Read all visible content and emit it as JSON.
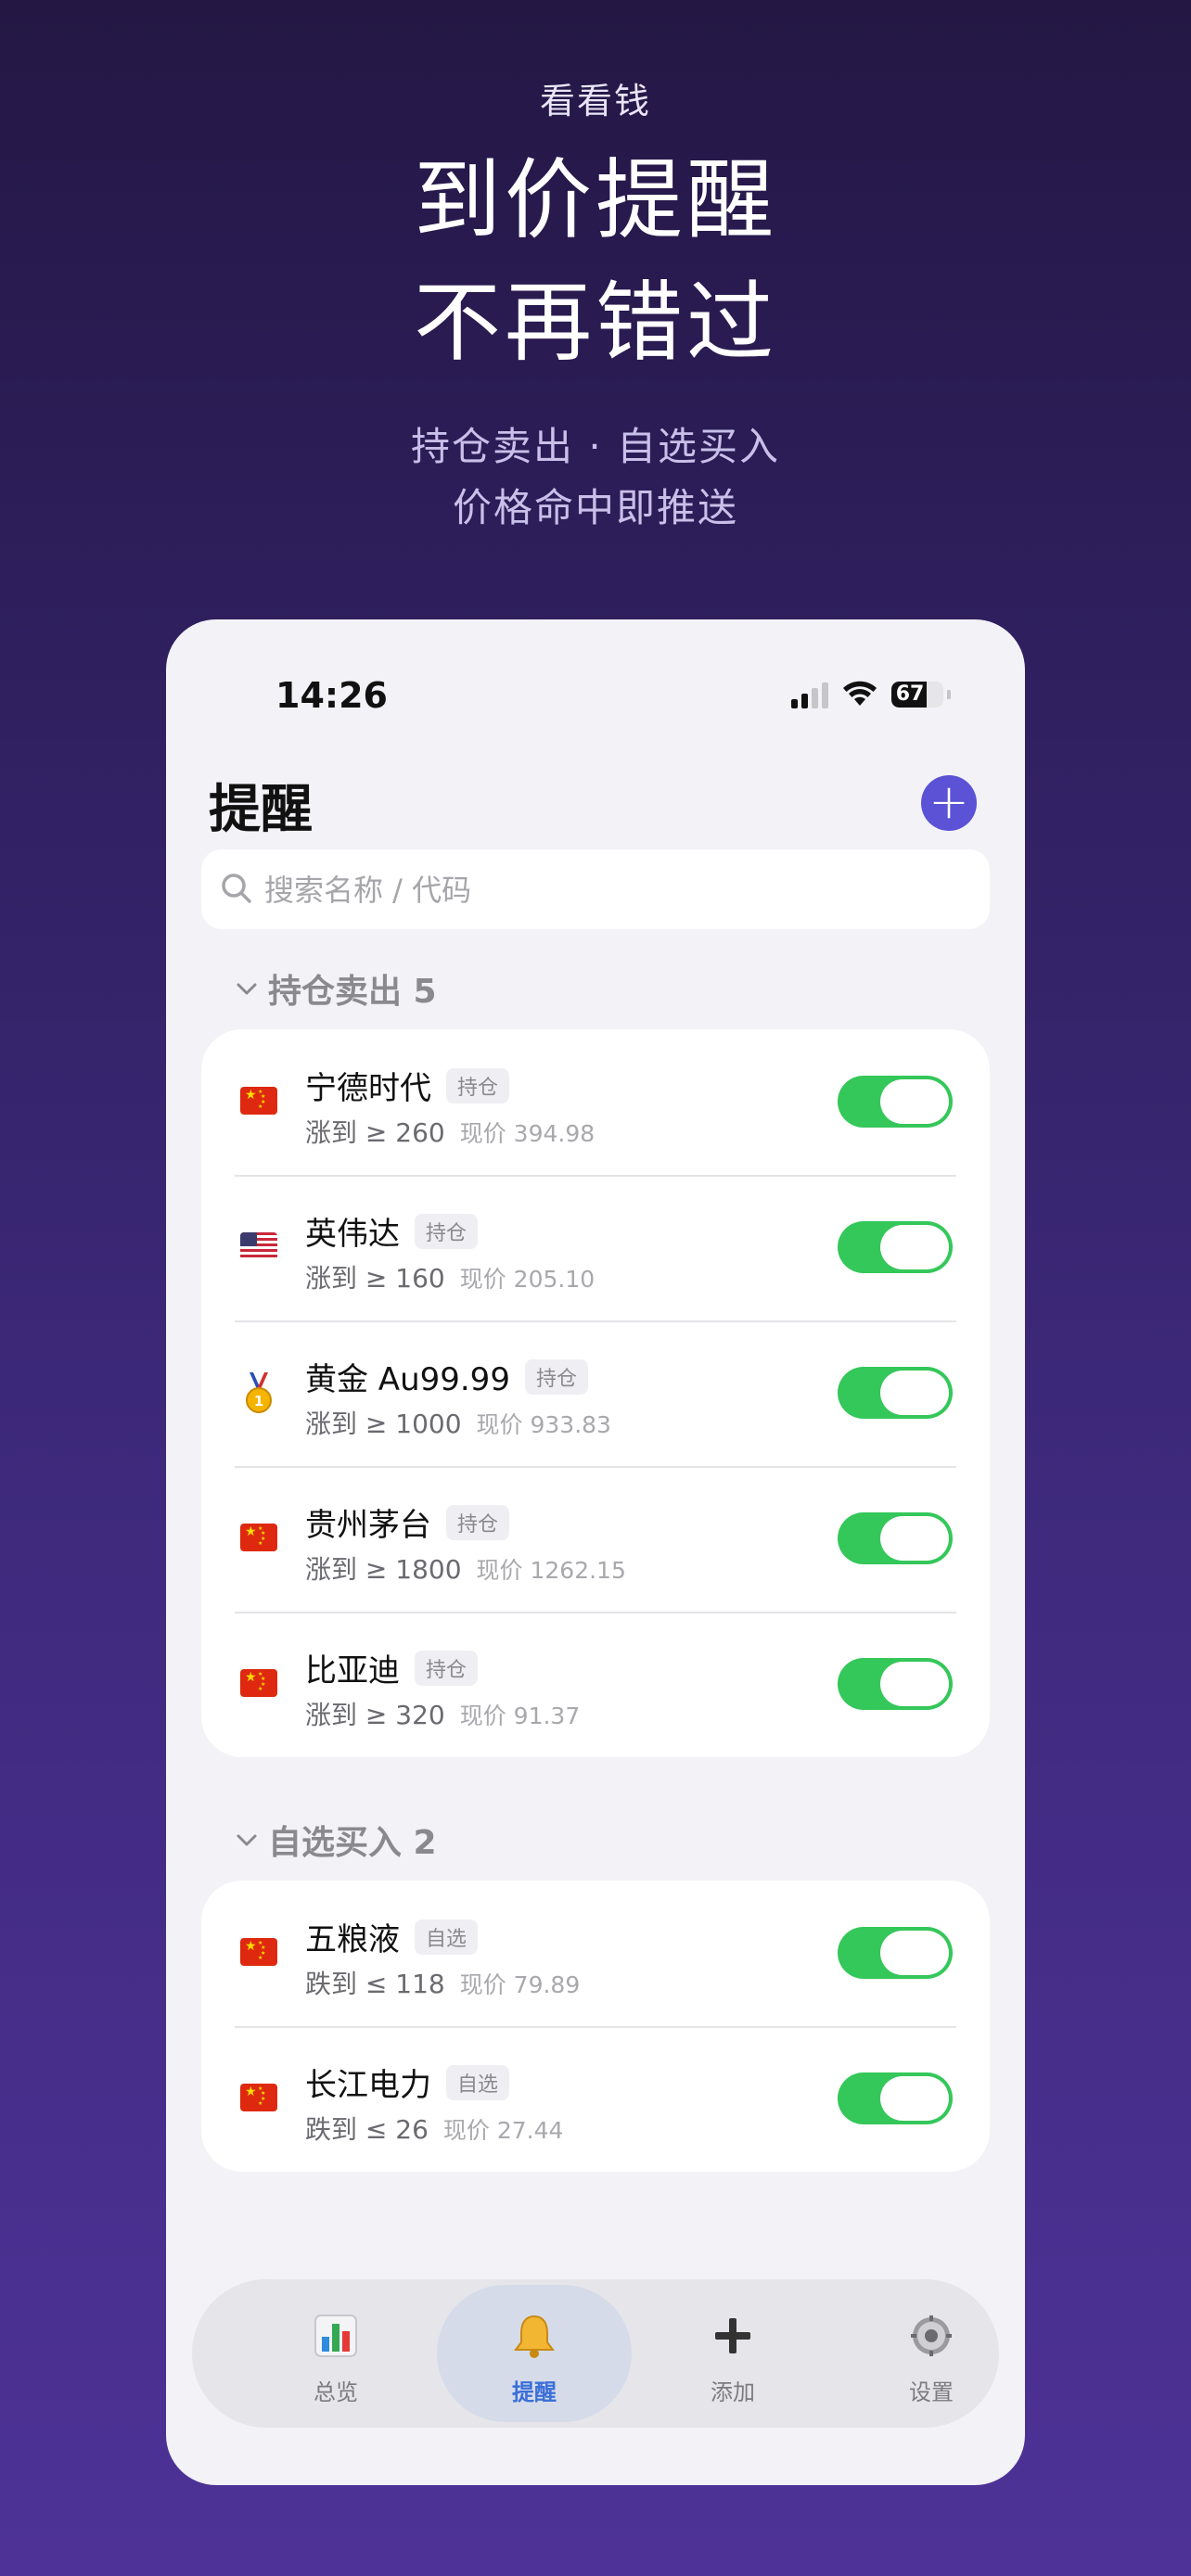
{
  "hero": {
    "app_name": "看看钱",
    "headline_1": "到价提醒",
    "headline_2": "不再错过",
    "sub_1": "持仓卖出 · 自选买入",
    "sub_2": "价格命中即推送"
  },
  "status": {
    "time": "14:26",
    "battery": "67",
    "battery_level": 0.67
  },
  "page": {
    "title": "提醒",
    "search_placeholder": "搜索名称 / 代码",
    "add_icon": "plus-icon"
  },
  "sections": [
    {
      "title": "持仓卖出 5",
      "items": [
        {
          "flag": "cn",
          "name": "宁德时代",
          "tag": "持仓",
          "condition": "涨到 ≥ 260",
          "price": "现价 394.98",
          "enabled": true
        },
        {
          "flag": "us",
          "name": "英伟达",
          "tag": "持仓",
          "condition": "涨到 ≥ 160",
          "price": "现价 205.10",
          "enabled": true
        },
        {
          "flag": "gold",
          "name": "黄金 Au99.99",
          "tag": "持仓",
          "condition": "涨到 ≥ 1000",
          "price": "现价 933.83",
          "enabled": true
        },
        {
          "flag": "cn",
          "name": "贵州茅台",
          "tag": "持仓",
          "condition": "涨到 ≥ 1800",
          "price": "现价 1262.15",
          "enabled": true
        },
        {
          "flag": "cn",
          "name": "比亚迪",
          "tag": "持仓",
          "condition": "涨到 ≥ 320",
          "price": "现价 91.37",
          "enabled": true
        }
      ]
    },
    {
      "title": "自选买入 2",
      "items": [
        {
          "flag": "cn",
          "name": "五粮液",
          "tag": "自选",
          "condition": "跌到 ≤ 118",
          "price": "现价 79.89",
          "enabled": true
        },
        {
          "flag": "cn",
          "name": "长江电力",
          "tag": "自选",
          "condition": "跌到 ≤ 26",
          "price": "现价 27.44",
          "enabled": true
        }
      ]
    }
  ],
  "tabs": [
    {
      "label": "总览",
      "icon": "bar-chart-icon",
      "active": false
    },
    {
      "label": "提醒",
      "icon": "bell-icon",
      "active": true
    },
    {
      "label": "添加",
      "icon": "plus-icon",
      "active": false
    },
    {
      "label": "设置",
      "icon": "gear-icon",
      "active": false
    }
  ],
  "colors": {
    "accent": "#5b52d6",
    "toggle_on": "#34c759",
    "tab_active": "#3b6fd8"
  }
}
